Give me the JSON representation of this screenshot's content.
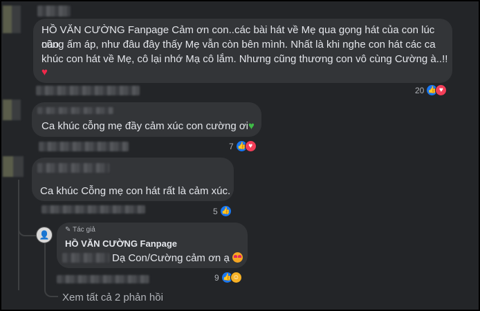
{
  "comments": [
    {
      "author": "HỒ VĂN CƯỜNG Fanpage",
      "text_line1": " Cảm ơn con..các bài hát về Mẹ qua gọng hát của con lúc nào",
      "text_line2": "cũng ấm áp, như đâu đây thấy Mẹ vẫn còn bên mình. Nhất là khi nghe con hát các ca",
      "text_line3": "khúc con hát về Mẹ, cô lại nhớ Mạ cô lắm. Nhưng cũng thương con vô cùng Cường à..!!",
      "emoji": "♥",
      "reaction_count": "20",
      "reactions": [
        "like-icon",
        "love-icon"
      ]
    },
    {
      "text": "Ca khúc cỗng mẹ đầy cảm xúc con cường ơi",
      "emoji": "♥",
      "reaction_count": "7",
      "reactions": [
        "like-icon",
        "love-icon"
      ]
    },
    {
      "text": "Ca khúc Cỗng mẹ con hát rất là cảm xúc.",
      "reaction_count": "5",
      "reactions": [
        "like-icon"
      ]
    }
  ],
  "reply": {
    "badge_icon": "pencil-icon",
    "badge_label": "Tác giả",
    "author": "HỒ VĂN CƯỜNG Fanpage",
    "text": "Dạ Con/Cường cảm ơn ạ",
    "reaction_count": "9",
    "reactions": [
      "like-icon",
      "care-icon"
    ]
  },
  "view_replies": "Xem tất cả 2 phản hồi",
  "colors": {
    "background": "#232528",
    "bubble": "#333538",
    "like": "#1877f2",
    "love": "#f33e58",
    "text": "#e4e6eb",
    "muted": "#b0b3b8"
  }
}
